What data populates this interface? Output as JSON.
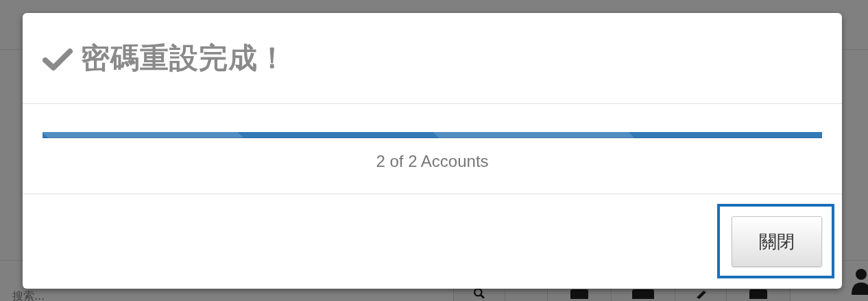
{
  "dialog": {
    "title": "密碼重設完成！",
    "progress": {
      "level": 1,
      "reading": "2 of 2 Accounts"
    },
    "buttons": [
      {
        "label": "關閉",
        "focused": true
      }
    ]
  },
  "toolbar": {
    "search": {
      "placeholder": "搜索..."
    }
  }
}
